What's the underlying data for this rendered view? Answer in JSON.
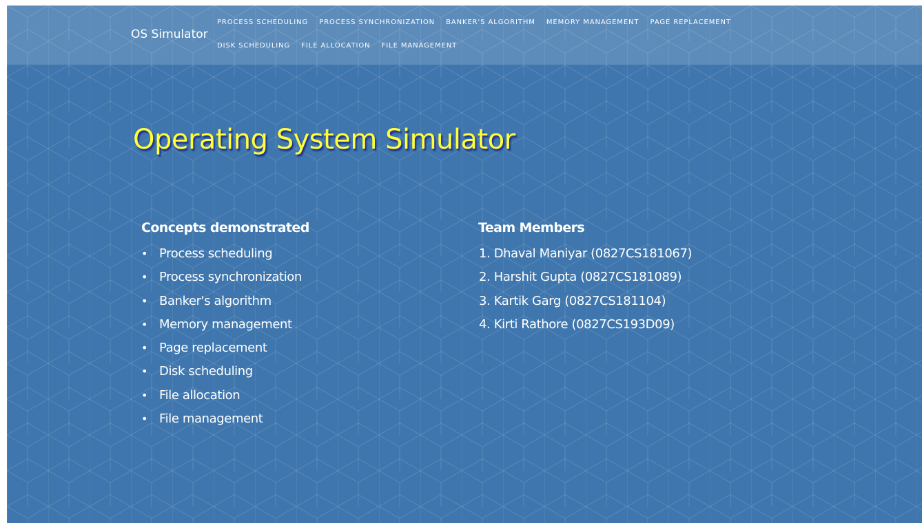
{
  "navbar": {
    "brand": "OS Simulator",
    "links": [
      "PROCESS SCHEDULING",
      "PROCESS SYNCHRONIZATION",
      "BANKER'S ALGORITHM",
      "MEMORY MANAGEMENT",
      "PAGE REPLACEMENT",
      "DISK SCHEDULING",
      "FILE ALLOCATION",
      "FILE MANAGEMENT"
    ]
  },
  "main": {
    "title": "Operating System Simulator",
    "concepts": {
      "heading": "Concepts demonstrated",
      "bullet": "•",
      "items": [
        "Process scheduling",
        "Process synchronization",
        "Banker's algorithm",
        "Memory management",
        "Page replacement",
        "Disk scheduling",
        "File allocation",
        "File management"
      ]
    },
    "team": {
      "heading": "Team Members",
      "members": [
        "1. Dhaval Maniyar (0827CS181067)",
        "2. Harshit Gupta (0827CS181089)",
        "3. Kartik Garg (0827CS181104)",
        "4. Kirti Rathore (0827CS193D09)"
      ]
    }
  },
  "colors": {
    "background": "#3e76ad",
    "title": "#ffff3a",
    "title_shadow": "#1f2b8c",
    "text": "#ffffff"
  }
}
